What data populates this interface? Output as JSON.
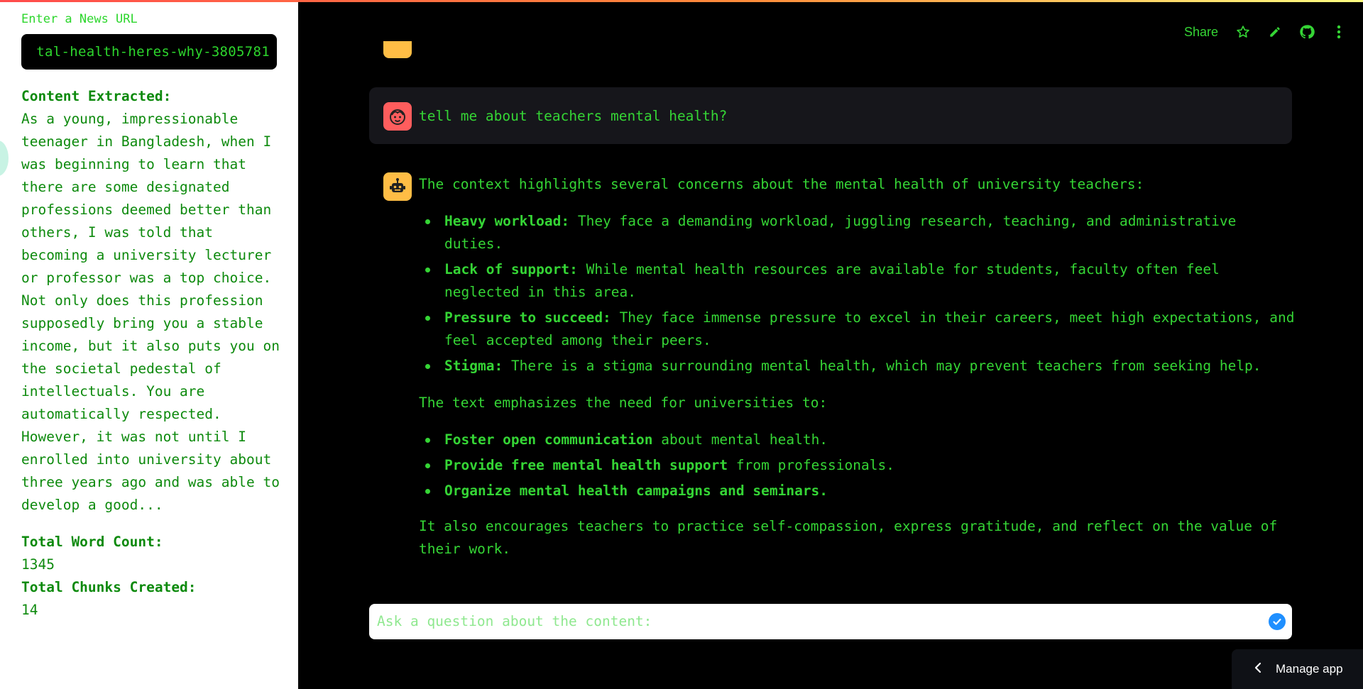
{
  "sidebar": {
    "url_label": "Enter a News URL",
    "url_value": "tal-health-heres-why-3805781",
    "content_heading": "Content Extracted:",
    "content_text": "As a young, impressionable teenager in Bangladesh, when I was beginning to learn that there are some designated professions deemed better than others, I was told that becoming a university lecturer or professor was a top choice. Not only does this profession supposedly bring you a stable income, but it also puts you on the societal pedestal of intellectuals. You are automatically respected. However, it was not until I enrolled into university about three years ago and was able to develop a good...",
    "word_count_label": "Total Word Count:",
    "word_count": "1345",
    "chunks_label": "Total Chunks Created:",
    "chunks": "14"
  },
  "toolbar": {
    "share_label": "Share",
    "icons": [
      "star-icon",
      "pencil-icon",
      "github-icon",
      "more-vertical-icon"
    ]
  },
  "chat": {
    "user_question": "tell me about teachers mental health?",
    "bot_intro": "The context highlights several concerns about the mental health of university teachers:",
    "concerns": [
      {
        "title": "Heavy workload:",
        "text": "They face a demanding workload, juggling research, teaching, and administrative duties."
      },
      {
        "title": "Lack of support:",
        "text": "While mental health resources are available for students, faculty often feel neglected in this area."
      },
      {
        "title": "Pressure to succeed:",
        "text": "They face immense pressure to excel in their careers, meet high expectations, and feel accepted among their peers."
      },
      {
        "title": "Stigma:",
        "text": "There is a stigma surrounding mental health, which may prevent teachers from seeking help."
      }
    ],
    "needs_intro": "The text emphasizes the need for universities to:",
    "needs": [
      {
        "title": "Foster open communication",
        "text": "about mental health."
      },
      {
        "title": "Provide free mental health support",
        "text": "from professionals."
      },
      {
        "title": "Organize mental health campaigns and seminars.",
        "text": ""
      }
    ],
    "closing": "It also encourages teachers to practice self-compassion, express gratitude, and reflect on the value of their work."
  },
  "input": {
    "placeholder": "Ask a question about the content:"
  },
  "manage_app": {
    "label": "Manage app"
  },
  "colors": {
    "accent_green": "#35d535",
    "sidebar_text": "#0d8a0d",
    "user_avatar": "#ff5d5d",
    "bot_avatar": "#ffbd45",
    "send_button": "#1f8fff"
  }
}
